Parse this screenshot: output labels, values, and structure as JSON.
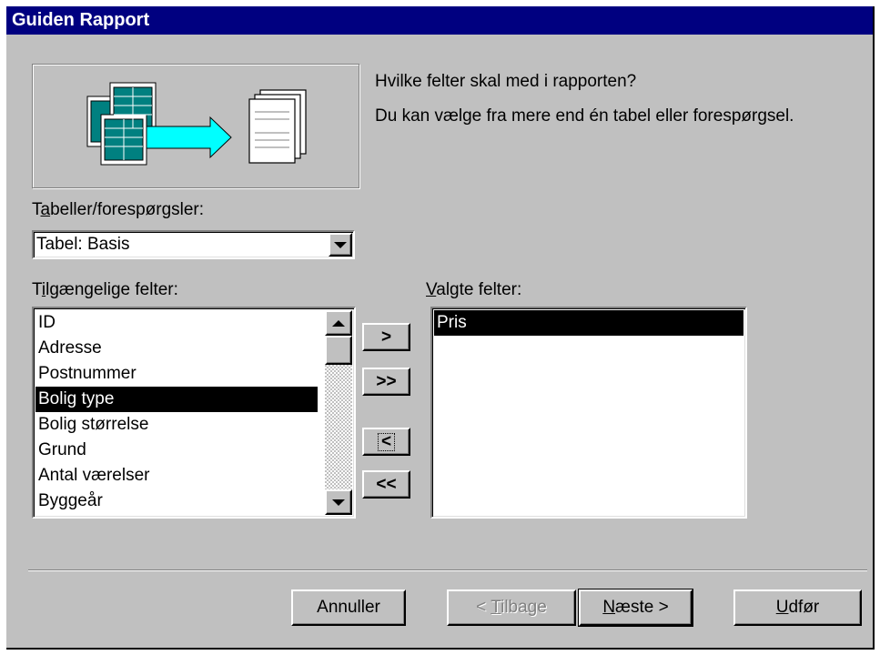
{
  "window": {
    "title": "Guiden Rapport"
  },
  "intro": {
    "question": "Hvilke felter skal med i rapporten?",
    "hint": "Du kan vælge fra mere end én tabel eller forespørgsel."
  },
  "tables": {
    "label_pre": "T",
    "label_accel": "a",
    "label_post": "beller/forespørgsler:",
    "selected": "Tabel: Basis"
  },
  "available": {
    "label_pre": "T",
    "label_accel": "i",
    "label_post": "lgængelige felter:",
    "items": [
      "ID",
      "Adresse",
      "Postnummer",
      "Bolig type",
      "Bolig størrelse",
      "Grund",
      "Antal værelser",
      "Byggeår"
    ],
    "selected_index": 3
  },
  "chosen": {
    "label_accel": "V",
    "label_post": "algte felter:",
    "items": [
      "Pris"
    ]
  },
  "move_buttons": {
    "add_one": ">",
    "add_all": ">>",
    "remove_one": "<",
    "remove_all": "<<"
  },
  "footer": {
    "cancel": "Annuller",
    "back_pre": "< ",
    "back_accel": "T",
    "back_post": "ilbage",
    "next_accel": "N",
    "next_post": "æste >",
    "finish_accel": "U",
    "finish_post": "dfør"
  },
  "colors": {
    "titlebar": "#000080",
    "face": "#c0c0c0",
    "selection": "#000000"
  },
  "icons": [
    "wizard-illustration-icon",
    "dropdown-arrow-icon",
    "scroll-up-icon",
    "scroll-down-icon"
  ]
}
